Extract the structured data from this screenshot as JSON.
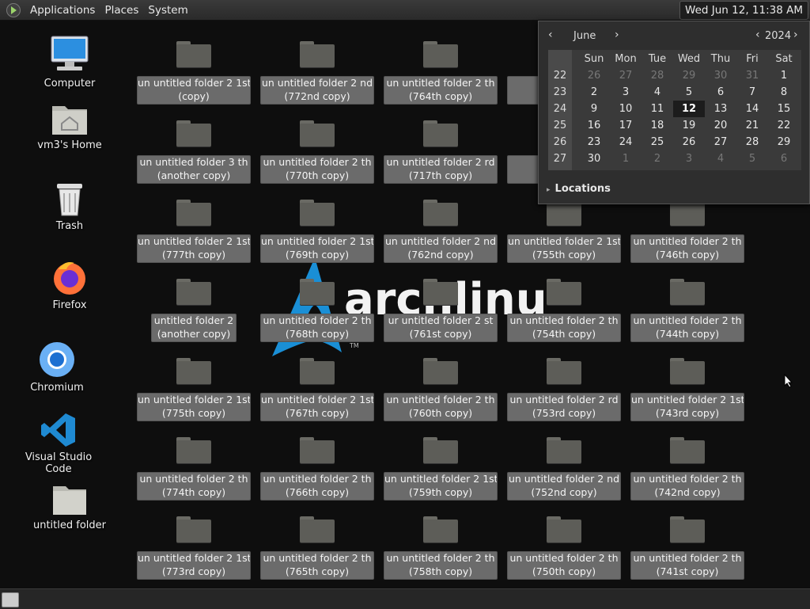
{
  "top_panel": {
    "menus": [
      "Applications",
      "Places",
      "System"
    ],
    "clock": "Wed Jun 12, 11:38 AM"
  },
  "background": {
    "logo_text": "archlinux",
    "logo_tm": "TM"
  },
  "desktop_icons": [
    {
      "label": "Computer",
      "icon": "computer-icon"
    },
    {
      "label": "vm3's Home",
      "icon": "home-folder-icon"
    },
    {
      "label": "Trash",
      "icon": "trash-icon"
    },
    {
      "label": "Firefox",
      "icon": "firefox-icon"
    },
    {
      "label": "Chromium",
      "icon": "chromium-icon"
    },
    {
      "label": "Visual Studio Code",
      "icon": "vscode-icon"
    },
    {
      "label": "untitled folder",
      "icon": "folder-icon"
    }
  ],
  "folders": [
    [
      "un untitled folder 2 1st",
      "(copy)"
    ],
    [
      "un untitled folder 2 nd",
      "(772nd copy)"
    ],
    [
      "un untitled folder 2 th",
      "(764th copy)"
    ],
    [
      "un",
      ""
    ],
    [
      "un untitled folder 3 th",
      "(another copy)"
    ],
    [
      "un untitled folder 2 th",
      "(770th copy)"
    ],
    [
      "un untitled folder 2 rd",
      "(717th copy)"
    ],
    [
      "un unt",
      "("
    ],
    [
      "un untitled folder 2 1st",
      "(777th copy)"
    ],
    [
      "un untitled folder 2 1st",
      "(769th copy)"
    ],
    [
      "un untitled folder 2 nd",
      "(762nd copy)"
    ],
    [
      "un untitled folder 2 1st",
      "(755th copy)"
    ],
    [
      "un untitled folder 2 th",
      "(746th copy)"
    ],
    [
      "untitled folder 2",
      "(another copy)"
    ],
    [
      "un untitled folder 2 th",
      "(768th copy)"
    ],
    [
      "ur untitled folder 2 st",
      "(761st copy)"
    ],
    [
      "un untitled folder 2 th",
      "(754th copy)"
    ],
    [
      "un untitled folder 2 th",
      "(744th copy)"
    ],
    [
      "un untitled folder 2 1st",
      "(775th copy)"
    ],
    [
      "un untitled folder 2 1st",
      "(767th copy)"
    ],
    [
      "un untitled folder 2 th",
      "(760th copy)"
    ],
    [
      "un untitled folder 2 rd",
      "(753rd copy)"
    ],
    [
      "un untitled folder 2 1st",
      "(743rd copy)"
    ],
    [
      "un untitled folder 2 th",
      "(774th copy)"
    ],
    [
      "un untitled folder 2 th",
      "(766th copy)"
    ],
    [
      "un untitled folder 2 1st",
      "(759th copy)"
    ],
    [
      "un untitled folder 2 nd",
      "(752nd copy)"
    ],
    [
      "un untitled folder 2 th",
      "(742nd copy)"
    ],
    [
      "un untitled folder 2 1st",
      "(773rd copy)"
    ],
    [
      "un untitled folder 2 th",
      "(765th copy)"
    ],
    [
      "un untitled folder 2 th",
      "(758th copy)"
    ],
    [
      "un untitled folder 2 th",
      "(750th copy)"
    ],
    [
      "un untitled folder 2 th",
      "(741st copy)"
    ]
  ],
  "calendar": {
    "month": "June",
    "year": "2024",
    "weekdays": [
      "Sun",
      "Mon",
      "Tue",
      "Wed",
      "Thu",
      "Fri",
      "Sat"
    ],
    "weeks": [
      {
        "num": "22",
        "days": [
          "26",
          "27",
          "28",
          "29",
          "30",
          "31",
          "1"
        ]
      },
      {
        "num": "23",
        "days": [
          "2",
          "3",
          "4",
          "5",
          "6",
          "7",
          "8"
        ]
      },
      {
        "num": "24",
        "days": [
          "9",
          "10",
          "11",
          "12",
          "13",
          "14",
          "15"
        ]
      },
      {
        "num": "25",
        "days": [
          "16",
          "17",
          "18",
          "19",
          "20",
          "21",
          "22"
        ]
      },
      {
        "num": "26",
        "days": [
          "23",
          "24",
          "25",
          "26",
          "27",
          "28",
          "29"
        ]
      },
      {
        "num": "27",
        "days": [
          "30",
          "1",
          "2",
          "3",
          "4",
          "5",
          "6"
        ]
      }
    ],
    "today": "12",
    "locations_label": "Locations"
  }
}
